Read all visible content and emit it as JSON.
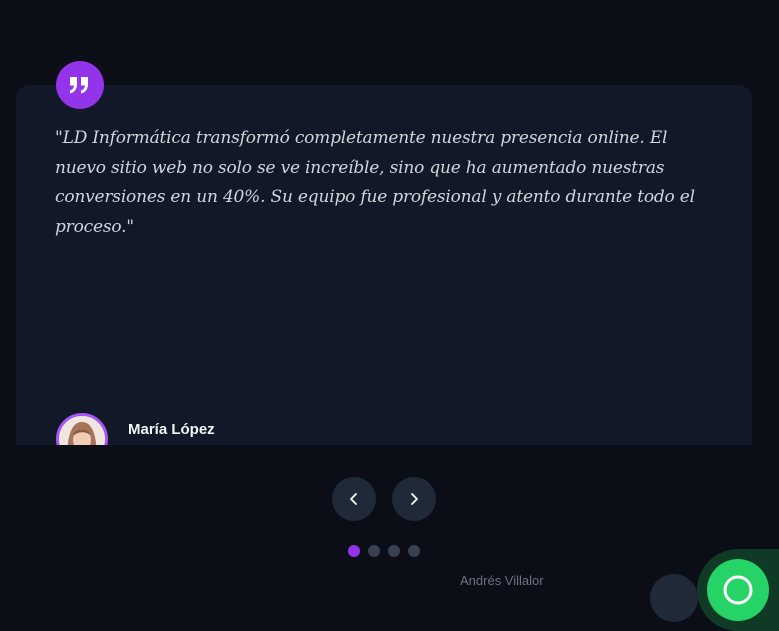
{
  "testimonial": {
    "quote": "\"LD Informática transformó completamente nuestra presencia online. El nuevo sitio web no solo se ve increíble, sino que ha aumentado nuestras conversiones en un 40%. Su equipo fue profesional y atento durante todo el proceso.\"",
    "author_name": "María López",
    "quote_icon": "quote-icon",
    "avatar_icon": "avatar"
  },
  "carousel": {
    "prev_icon": "chevron-left-icon",
    "next_icon": "chevron-right-icon",
    "slide_count": 4,
    "active_index": 0
  },
  "next_card_peek": {
    "name": "Andrés Villalor"
  },
  "floating": {
    "whatsapp_icon": "whatsapp-icon"
  },
  "colors": {
    "background": "#0b0d17",
    "card": "#111827",
    "accent": "#9333ea",
    "whatsapp": "#25d366"
  }
}
